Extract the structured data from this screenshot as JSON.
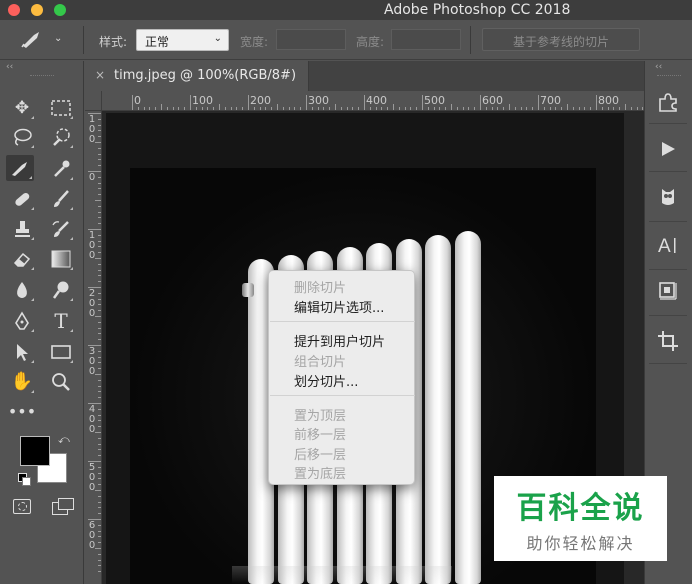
{
  "window": {
    "title": "Adobe Photoshop CC 2018"
  },
  "options_bar": {
    "style_label": "样式:",
    "style_value": "正常",
    "width_label": "宽度:",
    "height_label": "高度:",
    "guides_button": "基于参考线的切片"
  },
  "document": {
    "tab_close": "×",
    "tab_title": "timg.jpeg @ 100%(RGB/8#)"
  },
  "ruler": {
    "top_labels": [
      "0",
      "100",
      "200",
      "300",
      "400",
      "500",
      "600",
      "700",
      "800"
    ],
    "left_labels": [
      "1\n0\n0",
      "0",
      "1\n0\n0",
      "2\n0\n0",
      "3\n0\n0",
      "4\n0\n0",
      "5\n0\n0",
      "6\n0\n0"
    ]
  },
  "context_menu": {
    "group1": [
      {
        "label": "删除切片",
        "enabled": false
      },
      {
        "label": "编辑切片选项...",
        "enabled": true
      }
    ],
    "group2": [
      {
        "label": "提升到用户切片",
        "enabled": true
      },
      {
        "label": "组合切片",
        "enabled": false
      },
      {
        "label": "划分切片...",
        "enabled": true
      }
    ],
    "group3": [
      {
        "label": "置为顶层",
        "enabled": false
      },
      {
        "label": "前移一层",
        "enabled": false
      },
      {
        "label": "后移一层",
        "enabled": false
      },
      {
        "label": "置为底层",
        "enabled": false
      }
    ]
  },
  "colors": {
    "foreground": "#000000",
    "background": "#ffffff"
  },
  "watermark": {
    "main": "百科全说",
    "sub": "助你轻松解决"
  },
  "icons": {
    "tools": [
      "move-icon",
      "marquee-icon",
      "lasso-icon",
      "quick-select-icon",
      "slice-icon",
      "eyedropper-icon",
      "healing-brush-icon",
      "brush-icon",
      "clone-stamp-icon",
      "history-brush-icon",
      "eraser-icon",
      "gradient-icon",
      "blur-icon",
      "dodge-icon",
      "pen-icon",
      "type-icon",
      "path-select-icon",
      "rectangle-icon",
      "hand-icon",
      "zoom-icon",
      "more-tools-icon"
    ],
    "right_panel": [
      "puzzle-icon",
      "play-icon",
      "owl-icon",
      "character-icon",
      "cube-icon",
      "crop-icon"
    ]
  }
}
